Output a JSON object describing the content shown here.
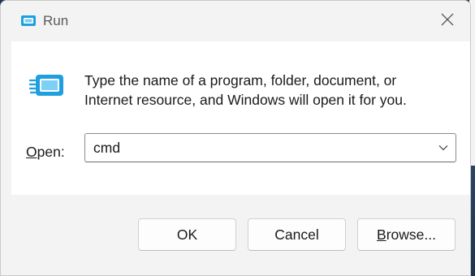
{
  "window": {
    "title": "Run",
    "accent_color": "#1ea0e0"
  },
  "content": {
    "description_line1": "Type the name of a program, folder, document, or",
    "description_line2": "Internet resource, and Windows will open it for you.",
    "open_label_accel": "O",
    "open_label_rest": "pen:",
    "open_value": "cmd"
  },
  "buttons": {
    "ok_label": "OK",
    "cancel_label": "Cancel",
    "browse_accel": "B",
    "browse_rest": "rowse..."
  },
  "icons": {
    "title": "run-icon",
    "close": "close-icon",
    "program": "run-program-icon",
    "dropdown": "chevron-down-icon"
  }
}
